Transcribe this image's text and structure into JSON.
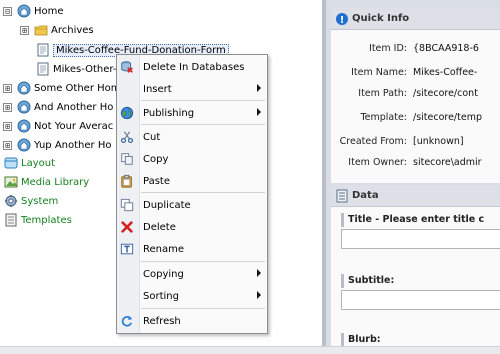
{
  "tree": {
    "nodes": [
      {
        "label": "Home",
        "expander": "⊟",
        "icon": "home-icon"
      },
      {
        "label": "Archives",
        "expander": "⊞",
        "icon": "folder-icon"
      },
      {
        "label": "Mikes-Coffee-Fund-Donation-Form",
        "icon": "document-icon"
      },
      {
        "label": "Mikes-Other-",
        "icon": "document-icon"
      },
      {
        "label": "Some Other Hom",
        "expander": "⊞",
        "icon": "home-icon"
      },
      {
        "label": "And Another Ho",
        "expander": "⊞",
        "icon": "home-icon"
      },
      {
        "label": "Not Your Averac",
        "expander": "⊞",
        "icon": "home-icon"
      },
      {
        "label": "Yup Another Ho",
        "expander": "⊞",
        "icon": "home-icon"
      },
      {
        "label": "Layout",
        "icon": "layout-icon"
      },
      {
        "label": "Media Library",
        "icon": "media-library-icon"
      },
      {
        "label": "System",
        "icon": "system-icon"
      },
      {
        "label": "Templates",
        "icon": "templates-icon"
      }
    ]
  },
  "context_menu": {
    "items": {
      "delete_in_databases": "Delete In Databases",
      "insert": "Insert",
      "publishing": "Publishing",
      "cut": "Cut",
      "copy": "Copy",
      "paste": "Paste",
      "duplicate": "Duplicate",
      "delete": "Delete",
      "rename": "Rename",
      "copying": "Copying",
      "sorting": "Sorting",
      "refresh": "Refresh"
    }
  },
  "quick_info": {
    "title": "Quick Info",
    "rows": [
      {
        "key": "Item ID:",
        "value": "{8BCAA918-6"
      },
      {
        "key": "Item Name:",
        "value": "Mikes-Coffee-"
      },
      {
        "key": "Item Path:",
        "value": "/sitecore/cont"
      },
      {
        "key": "Template:",
        "value": "/sitecore/temp"
      },
      {
        "key": "Created From:",
        "value": "[unknown]"
      },
      {
        "key": "Item Owner:",
        "value": "sitecore\\admir"
      }
    ]
  },
  "data_section": {
    "title": "Data",
    "fields": [
      {
        "label": "Title - Please enter title c"
      },
      {
        "label": "Subtitle:"
      },
      {
        "label": "Blurb:"
      }
    ]
  },
  "colors": {
    "green_label": "#17801f",
    "selection": "#e6eefb",
    "menu_bg": "#fafafa",
    "panel_bg": "#d9dde4"
  }
}
